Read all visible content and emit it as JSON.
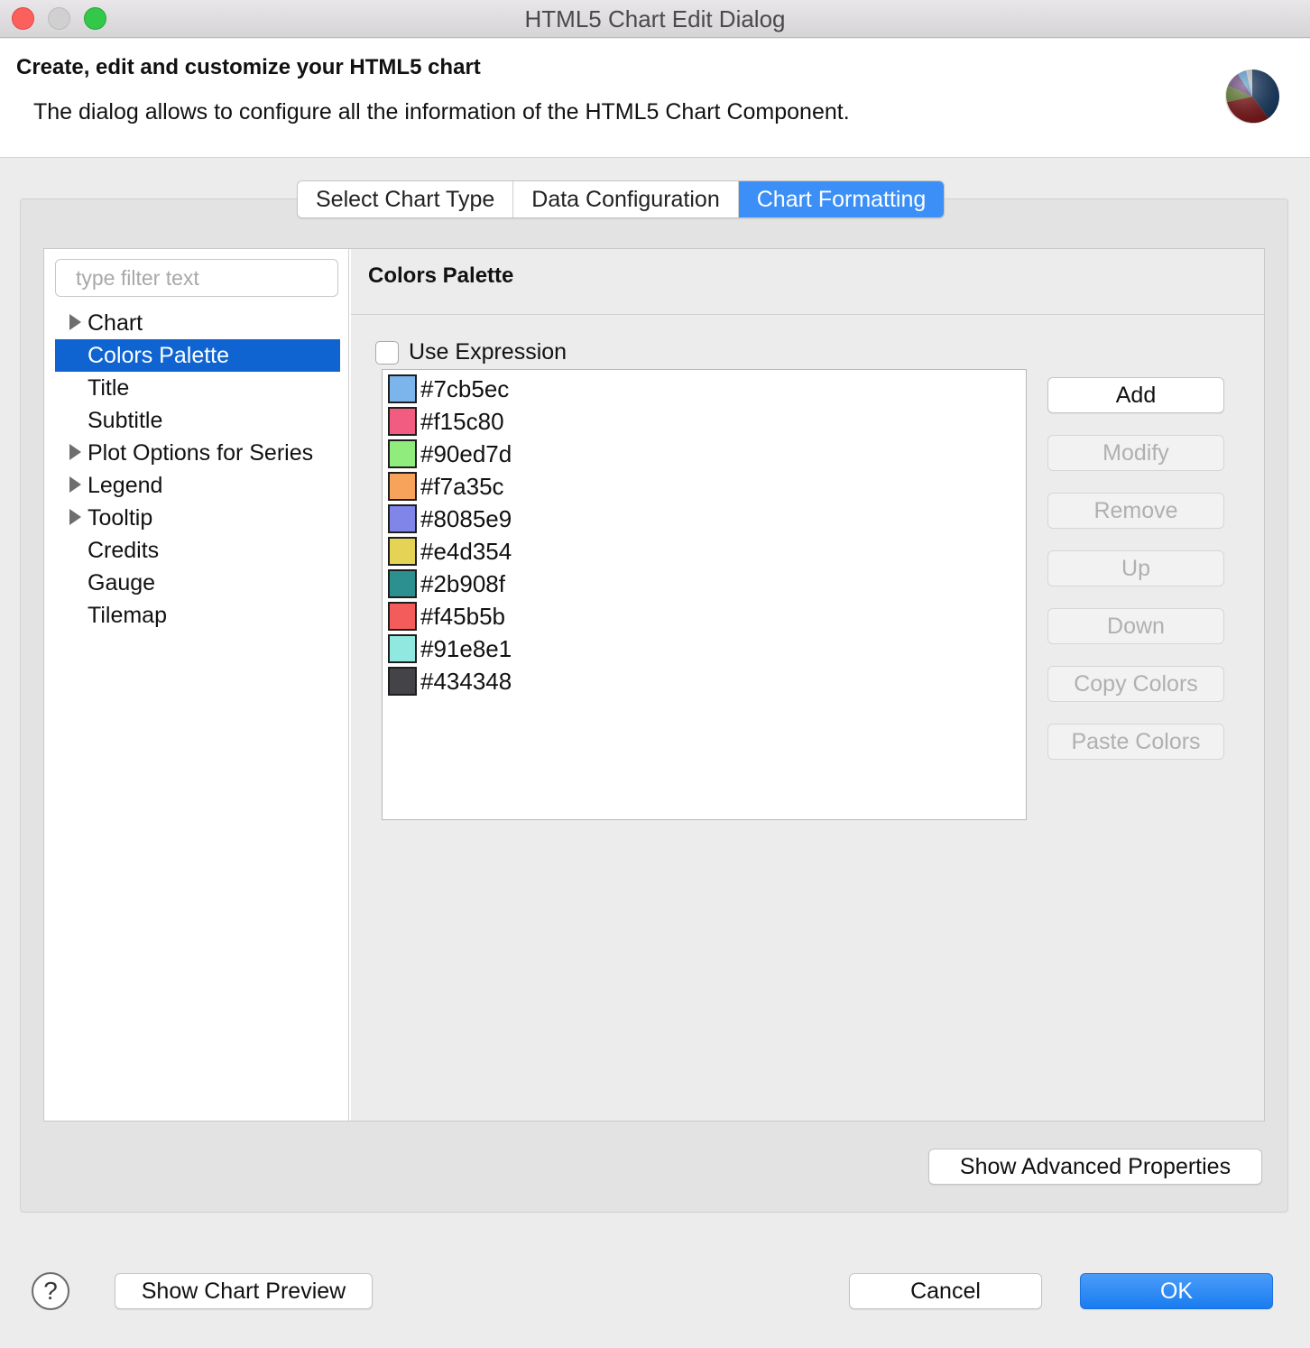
{
  "window": {
    "title": "HTML5 Chart Edit Dialog"
  },
  "header": {
    "title": "Create, edit and customize your HTML5 chart",
    "description": "The dialog allows to configure all the information of the HTML5 Chart Component.",
    "icon": "pie-chart-icon"
  },
  "tabs": [
    {
      "label": "Select Chart Type",
      "active": false
    },
    {
      "label": "Data Configuration",
      "active": false
    },
    {
      "label": "Chart Formatting",
      "active": true
    }
  ],
  "sidebar": {
    "filter_placeholder": "type filter text",
    "items": [
      {
        "label": "Chart",
        "expandable": true,
        "selected": false
      },
      {
        "label": "Colors Palette",
        "expandable": false,
        "selected": true
      },
      {
        "label": "Title",
        "expandable": false,
        "selected": false
      },
      {
        "label": "Subtitle",
        "expandable": false,
        "selected": false
      },
      {
        "label": "Plot Options for Series",
        "expandable": true,
        "selected": false
      },
      {
        "label": "Legend",
        "expandable": true,
        "selected": false
      },
      {
        "label": "Tooltip",
        "expandable": true,
        "selected": false
      },
      {
        "label": "Credits",
        "expandable": false,
        "selected": false
      },
      {
        "label": "Gauge",
        "expandable": false,
        "selected": false
      },
      {
        "label": "Tilemap",
        "expandable": false,
        "selected": false
      }
    ]
  },
  "palette": {
    "section_title": "Colors Palette",
    "use_expression_label": "Use Expression",
    "use_expression_checked": false,
    "colors": [
      {
        "label": "#7cb5ec",
        "swatch": "#7cb5ec"
      },
      {
        "label": "#f15c80",
        "swatch": "#f15c80"
      },
      {
        "label": "#90ed7d",
        "swatch": "#90ed7d"
      },
      {
        "label": "#f7a35c",
        "swatch": "#f7a35c"
      },
      {
        "label": "#8085e9",
        "swatch": "#8085e9"
      },
      {
        "label": "#e4d354",
        "swatch": "#e4d354"
      },
      {
        "label": "#2b908f",
        "swatch": "#2b908f"
      },
      {
        "label": "#f45b5b",
        "swatch": "#f45b5b"
      },
      {
        "label": "#91e8e1",
        "swatch": "#91e8e1"
      },
      {
        "label": "#434348",
        "swatch": "#434348"
      }
    ],
    "buttons": [
      {
        "label": "Add",
        "enabled": true
      },
      {
        "label": "Modify",
        "enabled": false
      },
      {
        "label": "Remove",
        "enabled": false
      },
      {
        "label": "Up",
        "enabled": false
      },
      {
        "label": "Down",
        "enabled": false
      },
      {
        "label": "Copy Colors",
        "enabled": false
      },
      {
        "label": "Paste Colors",
        "enabled": false
      }
    ]
  },
  "footer": {
    "advanced_label": "Show Advanced Properties",
    "preview_label": "Show Chart Preview",
    "cancel_label": "Cancel",
    "ok_label": "OK",
    "help_symbol": "?"
  },
  "colors": {
    "accent": "#3b8ff6",
    "selection": "#0f64d2"
  }
}
